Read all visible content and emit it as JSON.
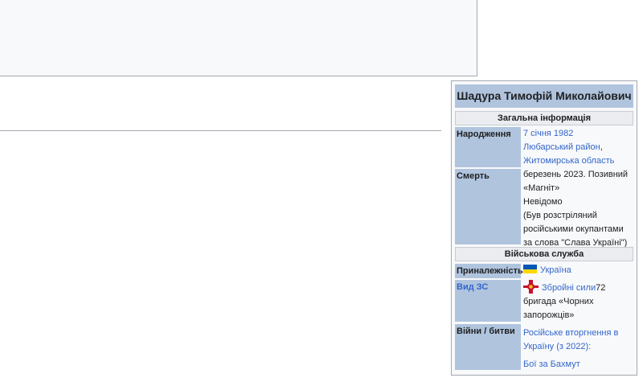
{
  "infobox": {
    "title": "Шадура Тимофій Миколайович",
    "section_general": "Загальна інформація",
    "section_military": "Військова служба",
    "rows": {
      "birth": {
        "label": "Народження",
        "date": "7 січня 1982",
        "district": "Любарський район",
        "district_suffix": ",",
        "region": "Житомирська область"
      },
      "death": {
        "label": "Смерть",
        "lines": [
          "березень 2023. Позивний",
          "«Магніт»",
          "Невідомо",
          "(Був розстріляний",
          "російськими окупантами",
          "за слова \"Слава Україні\")"
        ]
      },
      "allegiance": {
        "label": "Приналежність",
        "value": "Україна",
        "flag_colors": [
          "#0057b7",
          "#ffd700"
        ]
      },
      "branch": {
        "label": "Вид ЗС",
        "link": "Збройні сили",
        "suffix": "72",
        "line2": "бригада «Чорних",
        "line3": "запорожців»",
        "emblem_color": "#c8102e"
      },
      "wars": {
        "label": "Війни / битви",
        "war_line1": "Російське вторгнення в",
        "war_line2": "Україну (з 2022):",
        "battle": "Бої за Бахмут"
      }
    }
  },
  "colors": {
    "label_bg": "#b0c4de",
    "header_bg": "#eaecf0",
    "link": "#3366cc",
    "border": "#a2a9b1"
  }
}
